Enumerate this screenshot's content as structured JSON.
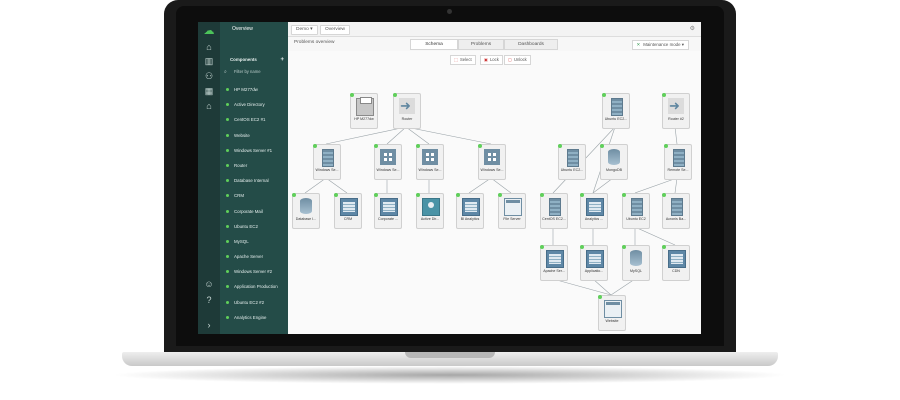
{
  "app": {
    "breadcrumb": [
      "Demo",
      "Overview"
    ],
    "subtitle": "Problems overview",
    "tabs": [
      {
        "label": "Schema",
        "active": true
      },
      {
        "label": "Problems",
        "active": false
      },
      {
        "label": "Dashboards",
        "active": false
      }
    ],
    "maintenance_label": "Maintenance mode",
    "tools": {
      "select": "Select",
      "lock": "Lock",
      "unlock": "Unlock"
    }
  },
  "sidebar": {
    "header": "Overview",
    "section_title": "Components",
    "filter_placeholder": "Filter by name",
    "items": [
      "HP M277dw",
      "Active Directory",
      "CentOS EC2 #1",
      "Website",
      "Windows Server #1",
      "Router",
      "Database Internal",
      "CRM",
      "Corporate Mail",
      "Ubuntu EC2",
      "MySQL",
      "Apache Server",
      "Windows Server #2",
      "Application Production",
      "Ubuntu EC2 #2",
      "Analytics Engine"
    ],
    "status_color": "#5fd05a"
  },
  "rail_icons": [
    "cloud-logo-icon",
    "home-icon",
    "chart-icon",
    "team-icon",
    "calendar-icon",
    "building-icon",
    "user-icon",
    "help-icon",
    "expand-icon"
  ],
  "nodes": [
    {
      "id": "n1",
      "label": "HP M277dw",
      "icon": "printer"
    },
    {
      "id": "n2",
      "label": "Router",
      "icon": "router"
    },
    {
      "id": "n3",
      "label": "Windows Se...",
      "icon": "server"
    },
    {
      "id": "n4",
      "label": "Windows Se...",
      "icon": "windows"
    },
    {
      "id": "n5",
      "label": "Windows Se...",
      "icon": "windows"
    },
    {
      "id": "n6",
      "label": "Windows Se...",
      "icon": "windows"
    },
    {
      "id": "n7",
      "label": "Database I...",
      "icon": "database"
    },
    {
      "id": "n8",
      "label": "CRM",
      "icon": "app"
    },
    {
      "id": "n9",
      "label": "Corporate ...",
      "icon": "app"
    },
    {
      "id": "n10",
      "label": "Active Dir...",
      "icon": "user-dir"
    },
    {
      "id": "n11",
      "label": "BI Analytics",
      "icon": "app"
    },
    {
      "id": "n12",
      "label": "File Server",
      "icon": "web"
    },
    {
      "id": "n13",
      "label": "Ubuntu EC2...",
      "icon": "server"
    },
    {
      "id": "n14",
      "label": "Router #2",
      "icon": "router"
    },
    {
      "id": "n15",
      "label": "Ubuntu EC2...",
      "icon": "server"
    },
    {
      "id": "n16",
      "label": "MongoDB",
      "icon": "database"
    },
    {
      "id": "n17",
      "label": "Remote Se...",
      "icon": "server"
    },
    {
      "id": "n18",
      "label": "CentOS EC2...",
      "icon": "server"
    },
    {
      "id": "n19",
      "label": "Analytics ...",
      "icon": "app"
    },
    {
      "id": "n20",
      "label": "Ubuntu EC2",
      "icon": "server"
    },
    {
      "id": "n21",
      "label": "Acronis Ba...",
      "icon": "server"
    },
    {
      "id": "n22",
      "label": "Apache Ser...",
      "icon": "app"
    },
    {
      "id": "n23",
      "label": "Applicatio...",
      "icon": "app"
    },
    {
      "id": "n24",
      "label": "MySQL",
      "icon": "database"
    },
    {
      "id": "n25",
      "label": "CDN",
      "icon": "app"
    },
    {
      "id": "n26",
      "label": "Website",
      "icon": "web"
    }
  ],
  "edges": [
    [
      "n2",
      "n3"
    ],
    [
      "n2",
      "n4"
    ],
    [
      "n2",
      "n5"
    ],
    [
      "n2",
      "n6"
    ],
    [
      "n3",
      "n7"
    ],
    [
      "n3",
      "n8"
    ],
    [
      "n4",
      "n9"
    ],
    [
      "n5",
      "n10"
    ],
    [
      "n6",
      "n11"
    ],
    [
      "n6",
      "n12"
    ],
    [
      "n13",
      "n18"
    ],
    [
      "n13",
      "n19"
    ],
    [
      "n16",
      "n19"
    ],
    [
      "n14",
      "n17"
    ],
    [
      "n17",
      "n20"
    ],
    [
      "n17",
      "n21"
    ],
    [
      "n18",
      "n22"
    ],
    [
      "n19",
      "n23"
    ],
    [
      "n20",
      "n24"
    ],
    [
      "n20",
      "n25"
    ],
    [
      "n22",
      "n26"
    ],
    [
      "n23",
      "n26"
    ],
    [
      "n24",
      "n26"
    ]
  ]
}
